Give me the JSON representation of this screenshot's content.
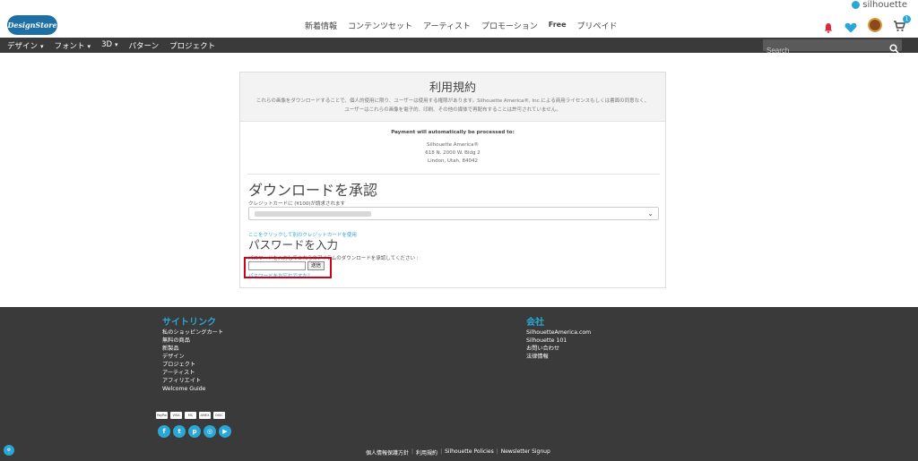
{
  "brand": {
    "silhouette": "silhouette",
    "logo_text": "DesignStore"
  },
  "topnav": [
    "新着情報",
    "コンテンツセット",
    "アーティスト",
    "プロモーション",
    "Free",
    "プリペイド"
  ],
  "cart": {
    "count": "1"
  },
  "navbar": {
    "items": [
      {
        "label": "デザイン",
        "dropdown": true
      },
      {
        "label": "フォント",
        "dropdown": true
      },
      {
        "label": "3D",
        "dropdown": true
      },
      {
        "label": "パターン",
        "dropdown": false
      },
      {
        "label": "プロジェクト",
        "dropdown": false
      }
    ],
    "search_placeholder": "Search"
  },
  "terms": {
    "title": "利用規約",
    "text": "これらの画像をダウンロードすることで、個人的使用に限り、ユーザーは使用する権限があります。Silhouette America®, Inc.による商用ライセンスもしくは書面の同意なく、ユーザーはこれらの画像を電子的、印刷、その他の媒体で再配布することは許可されていません。"
  },
  "payment": {
    "label": "Payment will automatically be processed to:",
    "address": [
      "Silhouette America®",
      "618 N. 2000 W. Bldg 2",
      "Lindon, Utah, 84042"
    ]
  },
  "approve": {
    "title": "ダウンロードを承認",
    "cc_note": "クレジットカードに (¥100)が請求されます",
    "other_card": "ここをクリックして別のクレジットカードを使用"
  },
  "password": {
    "title": "パスワードを入力",
    "note": "パスワードを入力してこれらのアイテムのダウンロードを承認してください :",
    "value": "",
    "submit": "送信",
    "forgot": "パスワードをお忘れですか？"
  },
  "footer": {
    "site_links_title": "サイトリンク",
    "site_links": [
      "私のショッピングカート",
      "無料の商品",
      "新製品",
      "デザイン",
      "プロジェクト",
      "アーティスト",
      "アフィリエイト",
      "Welcome Guide"
    ],
    "company_title": "会社",
    "company_links": [
      "SilhouetteAmerica.com",
      "Silhouette 101",
      "お問い合わせ",
      "法律情報"
    ],
    "legal": [
      "個人情報保護方針",
      "利用規約",
      "Silhouette Policies",
      "Newsletter Signup"
    ],
    "payment_methods": [
      "PayPal",
      "VISA",
      "MC",
      "AMEX",
      "DISC"
    ],
    "socials": [
      "facebook",
      "twitter",
      "pinterest",
      "instagram",
      "youtube"
    ]
  },
  "colors": {
    "accent": "#2aa7d6",
    "dark_bar": "#3a3a3a",
    "highlight": "#d0021b"
  }
}
